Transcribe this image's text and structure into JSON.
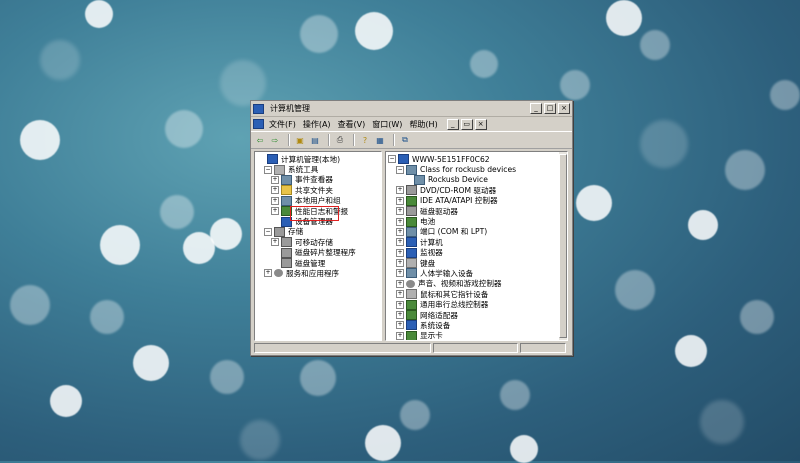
{
  "window": {
    "title": "计算机管理",
    "controls": {
      "minimize": "_",
      "maximize": "□",
      "close": "×"
    }
  },
  "menu": {
    "items": [
      "文件(F)",
      "操作(A)",
      "查看(V)",
      "窗口(W)",
      "帮助(H)"
    ],
    "child_controls": {
      "minimize": "_",
      "restore": "▭",
      "close": "×"
    }
  },
  "toolbar": {
    "buttons": [
      {
        "name": "back-icon",
        "glyph": "⇦"
      },
      {
        "name": "forward-icon",
        "glyph": "⇨"
      },
      {
        "name": "up-folder-icon",
        "glyph": "▣"
      },
      {
        "name": "show-hide-tree-icon",
        "glyph": "▤"
      },
      {
        "name": "print-icon",
        "glyph": "⎙"
      },
      {
        "name": "help-icon",
        "glyph": "?"
      },
      {
        "name": "properties-icon",
        "glyph": "▦"
      },
      {
        "name": "scan-hardware-icon",
        "glyph": "⧉"
      }
    ]
  },
  "tree": [
    {
      "label": "计算机管理(本地)",
      "level": 0,
      "exp": "",
      "icon": "comp"
    },
    {
      "label": "系统工具",
      "level": 1,
      "exp": "−",
      "icon": "tool"
    },
    {
      "label": "事件查看器",
      "level": 2,
      "exp": "+",
      "icon": "dev"
    },
    {
      "label": "共享文件夹",
      "level": 2,
      "exp": "+",
      "icon": "folder"
    },
    {
      "label": "本地用户和组",
      "level": 2,
      "exp": "+",
      "icon": "dev"
    },
    {
      "label": "性能日志和警报",
      "level": 2,
      "exp": "+",
      "icon": "chip"
    },
    {
      "label": "设备管理器",
      "level": 2,
      "exp": "",
      "icon": "comp"
    },
    {
      "label": "存储",
      "level": 1,
      "exp": "−",
      "icon": "disk"
    },
    {
      "label": "可移动存储",
      "level": 2,
      "exp": "+",
      "icon": "disk"
    },
    {
      "label": "磁盘碎片整理程序",
      "level": 2,
      "exp": "",
      "icon": "disk"
    },
    {
      "label": "磁盘管理",
      "level": 2,
      "exp": "",
      "icon": "disk"
    },
    {
      "label": "服务和应用程序",
      "level": 1,
      "exp": "+",
      "icon": "gear"
    }
  ],
  "devices": [
    {
      "label": "WWW-5E151FF0C62",
      "level": 0,
      "exp": "−",
      "icon": "comp"
    },
    {
      "label": "Class for rockusb devices",
      "level": 1,
      "exp": "−",
      "icon": "dev"
    },
    {
      "label": "Rockusb Device",
      "level": 2,
      "exp": "",
      "icon": "dev"
    },
    {
      "label": "DVD/CD-ROM 驱动器",
      "level": 1,
      "exp": "+",
      "icon": "disk"
    },
    {
      "label": "IDE ATA/ATAPI 控制器",
      "level": 1,
      "exp": "+",
      "icon": "chip"
    },
    {
      "label": "磁盘驱动器",
      "level": 1,
      "exp": "+",
      "icon": "disk"
    },
    {
      "label": "电池",
      "level": 1,
      "exp": "+",
      "icon": "chip"
    },
    {
      "label": "端口 (COM 和 LPT)",
      "level": 1,
      "exp": "+",
      "icon": "dev"
    },
    {
      "label": "计算机",
      "level": 1,
      "exp": "+",
      "icon": "comp"
    },
    {
      "label": "监视器",
      "level": 1,
      "exp": "+",
      "icon": "comp"
    },
    {
      "label": "键盘",
      "level": 1,
      "exp": "+",
      "icon": "tool"
    },
    {
      "label": "人体学输入设备",
      "level": 1,
      "exp": "+",
      "icon": "dev"
    },
    {
      "label": "声音、视频和游戏控制器",
      "level": 1,
      "exp": "+",
      "icon": "gear"
    },
    {
      "label": "鼠标和其它指针设备",
      "level": 1,
      "exp": "+",
      "icon": "tool"
    },
    {
      "label": "通用串行总线控制器",
      "level": 1,
      "exp": "+",
      "icon": "chip"
    },
    {
      "label": "网络适配器",
      "level": 1,
      "exp": "+",
      "icon": "chip"
    },
    {
      "label": "系统设备",
      "level": 1,
      "exp": "+",
      "icon": "comp"
    },
    {
      "label": "显示卡",
      "level": 1,
      "exp": "+",
      "icon": "chip"
    }
  ]
}
